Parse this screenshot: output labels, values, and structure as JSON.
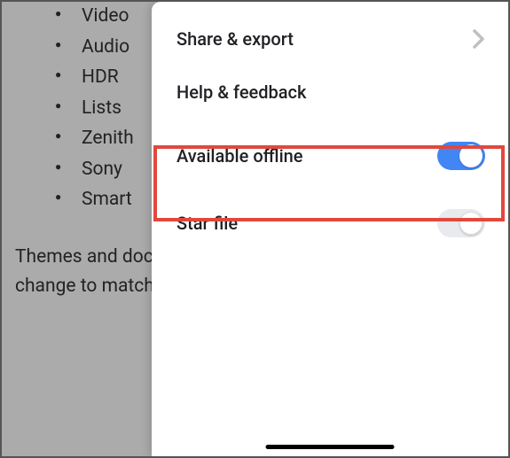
{
  "document": {
    "bullets": [
      "Video",
      "Audio",
      "HDR",
      "Lists",
      "Zenith",
      "Sony",
      "Smart"
    ],
    "paragraph": "Themes and document colors Design and pictures, charts change to match you apply styles match the new"
  },
  "panel": {
    "items": [
      {
        "label": "Share & export",
        "type": "nav"
      },
      {
        "label": "Help & feedback",
        "type": "plain"
      },
      {
        "label": "Available offline",
        "type": "toggle",
        "on": true
      },
      {
        "label": "Star file",
        "type": "toggle",
        "on": false
      }
    ]
  }
}
